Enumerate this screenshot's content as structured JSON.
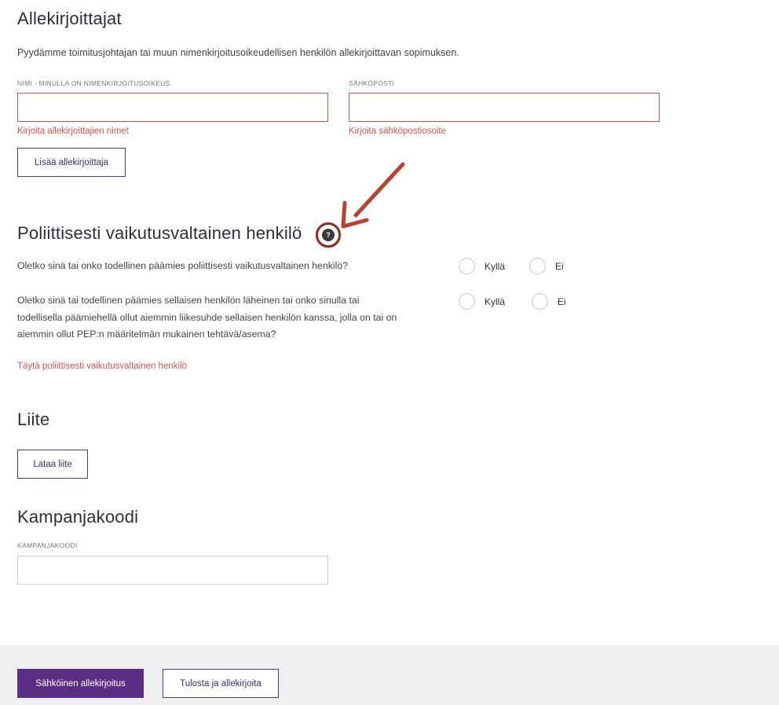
{
  "signers": {
    "title": "Allekirjoittajat",
    "description": "Pyydämme toimitusjohtajan tai muun nimenkirjoitusoikeudellisen henkilön allekirjoittavan sopimuksen.",
    "name_label": "NIMI - MINULLA ON NIMENKIRJOITUSOIKEUS",
    "name_value": "",
    "name_error": "Kirjoita allekirjoittajien nimet",
    "email_label": "SÄHKÖPOSTI",
    "email_value": "",
    "email_error": "Kirjoita sähköpostiosoite",
    "add_button": "Lisää allekirjoittaja"
  },
  "pep": {
    "title": "Poliittisesti vaikutusvaltainen henkilö",
    "help_icon": "question-circle-icon",
    "question1": "Oletko sinä tai onko todellinen päämies poliittisesti vaikutusvaltainen henkilö?",
    "question2_line1": "Oletko sinä tai todellinen päämies sellaisen henkilön läheinen tai onko sinulla tai",
    "question2_line2": "todellisella päämiehellä ollut aiemmin liikesuhde sellaisen henkilön kanssa, jolla on tai on",
    "question2_line3": "aiemmin ollut PEP:n määritelmän mukainen tehtävä/asema?",
    "yes": "Kyllä",
    "no": "Ei",
    "error": "Täytä poliittisesti vaikutusvaltainen henkilö"
  },
  "attachment": {
    "title": "Liite",
    "upload_button": "Lataa liite"
  },
  "campaign": {
    "title": "Kampanjakoodi",
    "label": "KAMPANJAKOODI",
    "value": ""
  },
  "footer": {
    "esign_button": "Sähköinen allekirjoitus",
    "print_button": "Tulosta ja allekirjoita"
  },
  "colors": {
    "error": "#d9534f",
    "brand": "#5b2d84",
    "annotation": "#8b2e21"
  }
}
